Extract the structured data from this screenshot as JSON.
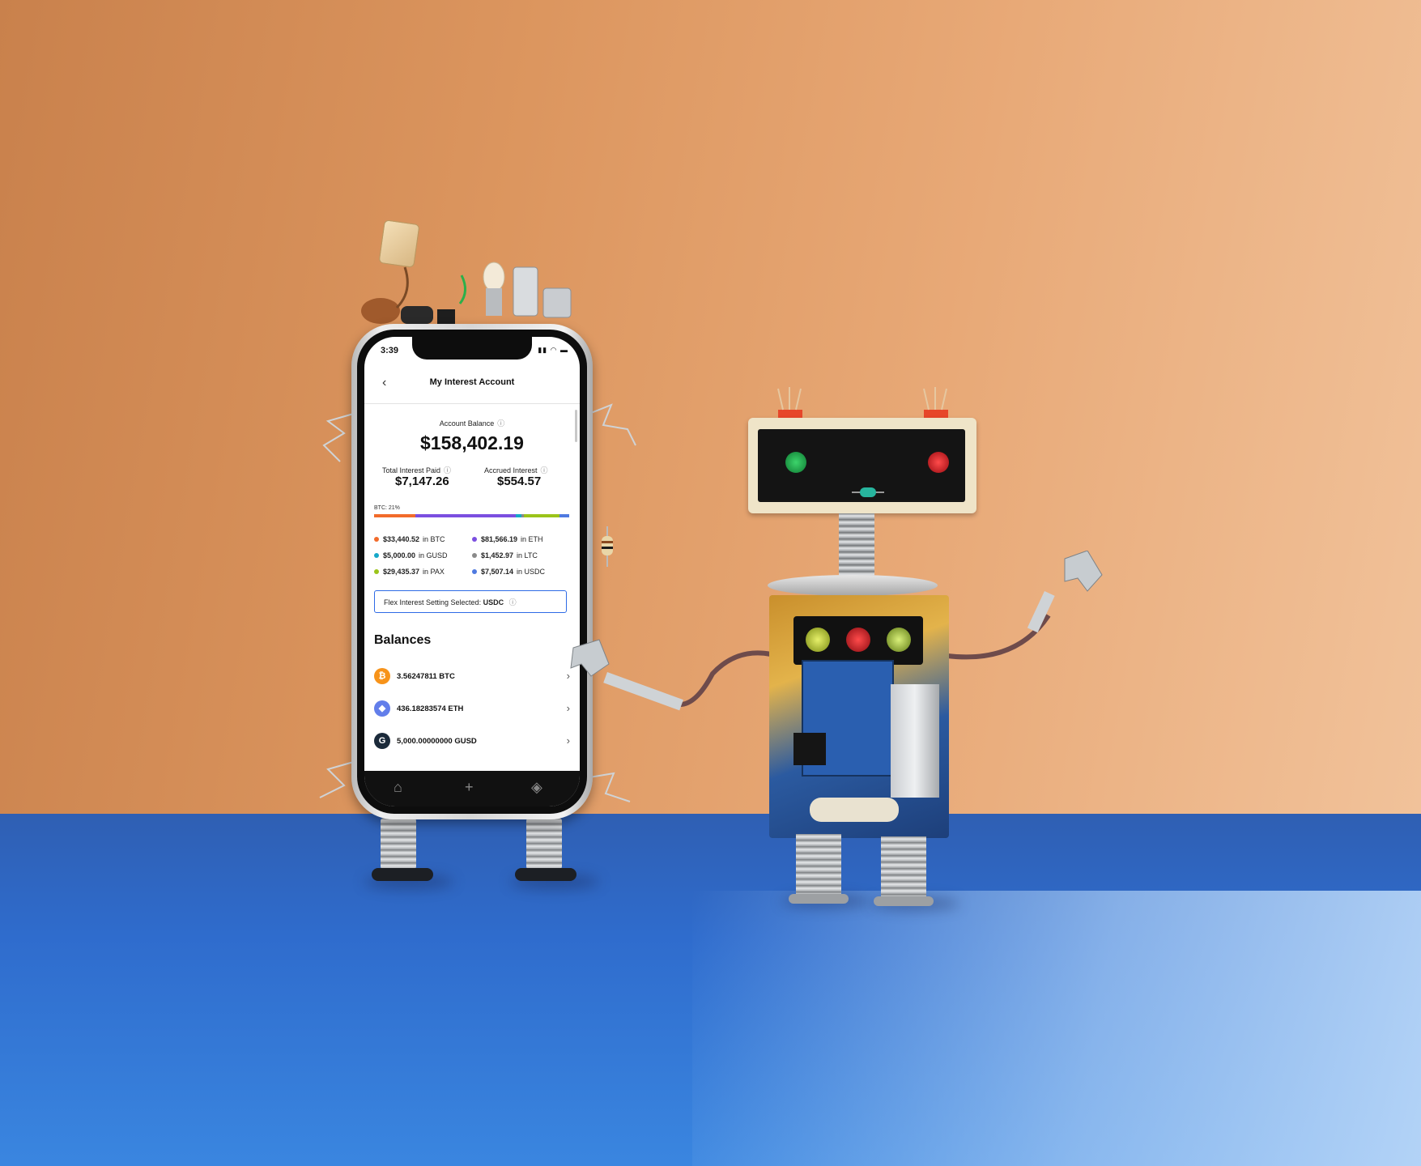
{
  "app": {
    "status_time": "3:39",
    "title": "My Interest Account"
  },
  "account": {
    "balance_label": "Account Balance",
    "balance": "$158,402.19",
    "total_interest_label": "Total Interest Paid",
    "total_interest": "$7,147.26",
    "accrued_label": "Accrued Interest",
    "accrued": "$554.57",
    "btc_percent_label": "BTC: 21%"
  },
  "allocation": [
    {
      "currency": "BTC",
      "fraction": 0.21,
      "color": "#f26b2b"
    },
    {
      "currency": "ETH",
      "fraction": 0.515,
      "color": "#7b4fe0"
    },
    {
      "currency": "GUSD",
      "fraction": 0.032,
      "color": "#16a8c9"
    },
    {
      "currency": "LTC",
      "fraction": 0.009,
      "color": "#8a8a8a"
    },
    {
      "currency": "PAX",
      "fraction": 0.186,
      "color": "#9bc41a"
    },
    {
      "currency": "USDC",
      "fraction": 0.047,
      "color": "#4f7ae0"
    }
  ],
  "holdings": [
    {
      "amount": "$33,440.52",
      "currency": "in BTC",
      "color": "#f26b2b"
    },
    {
      "amount": "$81,566.19",
      "currency": "in ETH",
      "color": "#7b4fe0"
    },
    {
      "amount": "$5,000.00",
      "currency": "in GUSD",
      "color": "#16a8c9"
    },
    {
      "amount": "$1,452.97",
      "currency": "in LTC",
      "color": "#8a8a8a"
    },
    {
      "amount": "$29,435.37",
      "currency": "in PAX",
      "color": "#9bc41a"
    },
    {
      "amount": "$7,507.14",
      "currency": "in USDC",
      "color": "#4f7ae0"
    }
  ],
  "flex": {
    "label": "Flex Interest Setting Selected:",
    "value": "USDC"
  },
  "balances": {
    "title": "Balances",
    "rows": [
      {
        "text": "3.56247811 BTC",
        "icon": "bitcoin-icon",
        "glyph": "₿",
        "color": "#f7931a"
      },
      {
        "text": "436.18283574 ETH",
        "icon": "ethereum-icon",
        "glyph": "◆",
        "color": "#627eea"
      },
      {
        "text": "5,000.00000000 GUSD",
        "icon": "gusd-icon",
        "glyph": "G",
        "color": "#1b2a3a"
      }
    ]
  },
  "icons": {
    "back": "chevron-left-icon",
    "info": "info-icon",
    "chevron": "chevron-right-icon",
    "tabs": [
      "home-icon",
      "plus-icon",
      "transfer-icon"
    ]
  },
  "colors": {
    "accent_border": "#2e6be6",
    "wall": "#dc965f",
    "floor": "#2f6ccd",
    "eye_left": "#1aa34a",
    "eye_right": "#e0202a"
  }
}
